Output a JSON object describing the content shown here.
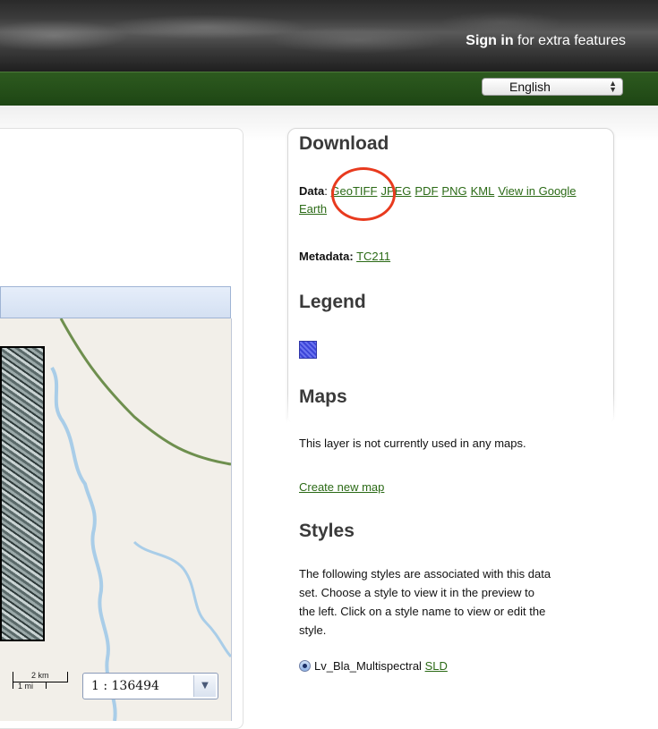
{
  "header": {
    "sign_in_label": "Sign in",
    "sign_in_suffix": " for extra features",
    "language_selected": "English"
  },
  "map": {
    "scale_km": "2 km",
    "scale_mi": "1 mi",
    "scale_ratio": "1 : 136494"
  },
  "download": {
    "title": "Download",
    "data_label": "Data",
    "links": [
      "GeoTIFF",
      "JPEG",
      "PDF",
      "PNG",
      "KML",
      "View in Google Earth"
    ],
    "metadata_label": "Metadata:",
    "metadata_link": "TC211"
  },
  "legend": {
    "title": "Legend"
  },
  "maps": {
    "title": "Maps",
    "description": "This layer is not currently used in any maps.",
    "create_link": "Create new map"
  },
  "styles": {
    "title": "Styles",
    "description_lines": [
      "The following styles are associated with this data",
      "set. Choose a style to view it in the preview to",
      "the left. Click on a style name to view or edit the",
      "style."
    ],
    "style_name": "Lv_Bla_Multispectral",
    "style_link": "SLD"
  },
  "colors": {
    "accent_green": "#2b6a16",
    "highlight_red": "#e83a1e",
    "legend_blue": "#4a52e0"
  }
}
